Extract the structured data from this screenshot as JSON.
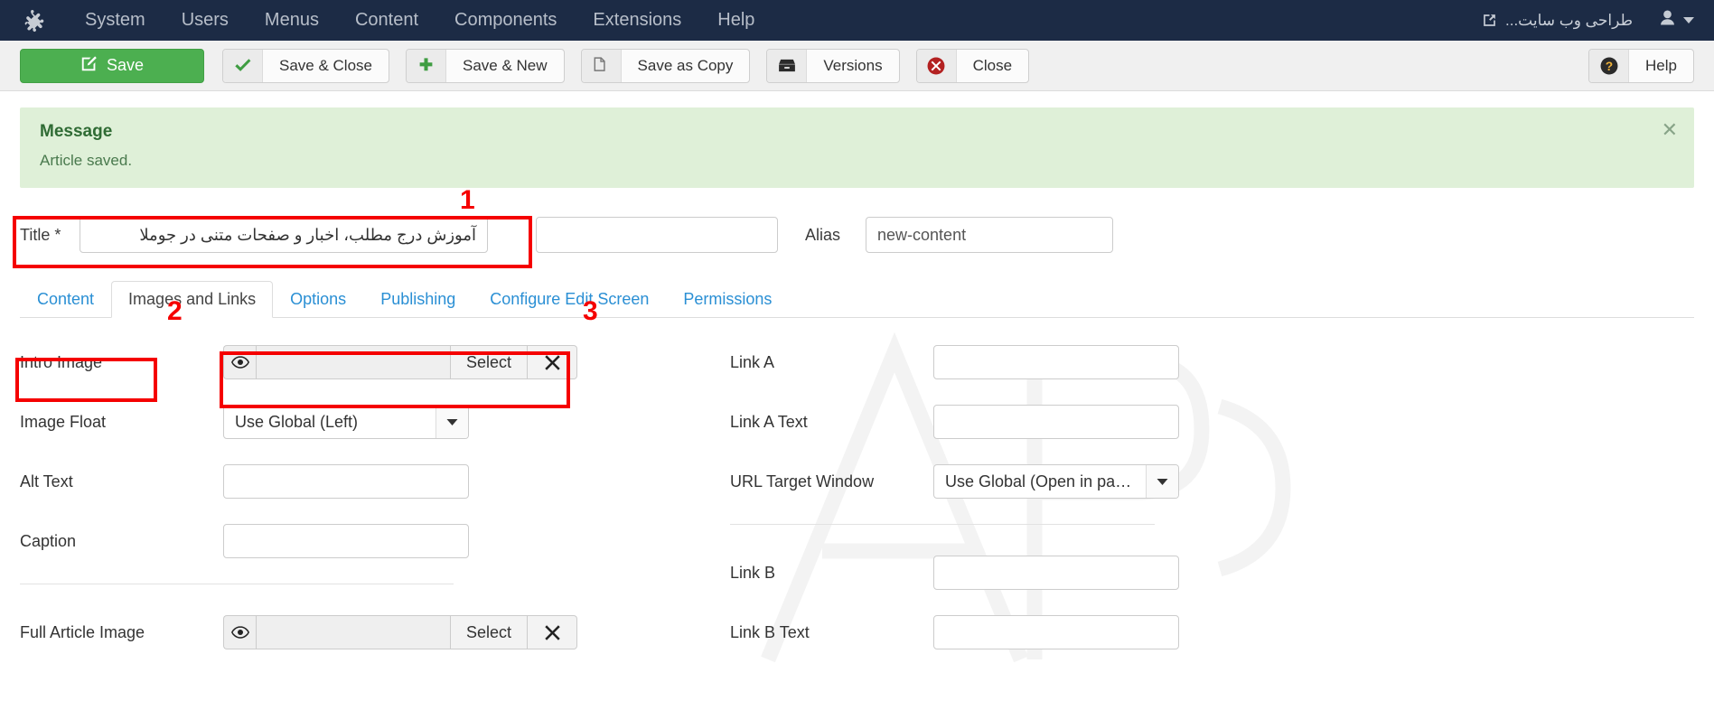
{
  "navbar": {
    "logo_icon": "joomla-logo-icon",
    "items": [
      {
        "label": "System"
      },
      {
        "label": "Users"
      },
      {
        "label": "Menus"
      },
      {
        "label": "Content"
      },
      {
        "label": "Components"
      },
      {
        "label": "Extensions"
      },
      {
        "label": "Help"
      }
    ],
    "site_link_label": "طراحی وب سایت...",
    "site_link_icon": "external-link-icon",
    "user_icon": "user-avatar-icon",
    "user_caret_icon": "chevron-down-icon",
    "background_color": "#1c2b45"
  },
  "toolbar": {
    "save": {
      "label": "Save",
      "icon": "pencil-square-icon",
      "color": "#4caf50"
    },
    "save_close": {
      "label": "Save & Close",
      "icon": "check-icon"
    },
    "save_new": {
      "label": "Save & New",
      "icon": "plus-icon"
    },
    "save_copy": {
      "label": "Save as Copy",
      "icon": "copy-icon"
    },
    "versions": {
      "label": "Versions",
      "icon": "archive-icon"
    },
    "close": {
      "label": "Close",
      "icon": "times-circle-icon"
    },
    "help": {
      "label": "Help",
      "icon": "question-circle-icon"
    }
  },
  "alert": {
    "title": "Message",
    "text": "Article saved.",
    "close_icon": "close-icon",
    "background_color": "#dff0d8",
    "text_color": "#3c763d"
  },
  "title_row": {
    "title_label": "Title *",
    "title_value": "آموزش درج مطلب، اخبار و صفحات متنی در جوملا",
    "alias_label": "Alias",
    "alias_value": "new-content",
    "extra_input_value": ""
  },
  "tabs": [
    {
      "label": "Content",
      "active": false
    },
    {
      "label": "Images and Links",
      "active": true
    },
    {
      "label": "Options",
      "active": false
    },
    {
      "label": "Publishing",
      "active": false
    },
    {
      "label": "Configure Edit Screen",
      "active": false
    },
    {
      "label": "Permissions",
      "active": false
    }
  ],
  "left_column": {
    "intro_image": {
      "label": "Intro Image",
      "value": "",
      "eye_icon": "eye-icon",
      "select_label": "Select",
      "clear_icon": "times-icon"
    },
    "image_float": {
      "label": "Image Float",
      "value": "Use Global (Left)",
      "arrow_icon": "caret-down-icon"
    },
    "alt_text": {
      "label": "Alt Text",
      "value": ""
    },
    "caption": {
      "label": "Caption",
      "value": ""
    },
    "full_article_image": {
      "label": "Full Article Image",
      "value": "",
      "eye_icon": "eye-icon",
      "select_label": "Select",
      "clear_icon": "times-icon"
    }
  },
  "right_column": {
    "link_a": {
      "label": "Link A",
      "value": ""
    },
    "link_a_text": {
      "label": "Link A Text",
      "value": ""
    },
    "url_target_window": {
      "label": "URL Target Window",
      "value": "Use Global (Open in parent ...",
      "arrow_icon": "caret-down-icon"
    },
    "link_b": {
      "label": "Link B",
      "value": ""
    },
    "link_b_text": {
      "label": "Link B Text",
      "value": ""
    }
  },
  "annotations": [
    {
      "number": "1",
      "color": "#f50000"
    },
    {
      "number": "2",
      "color": "#f50000"
    },
    {
      "number": "3",
      "color": "#f50000"
    }
  ]
}
